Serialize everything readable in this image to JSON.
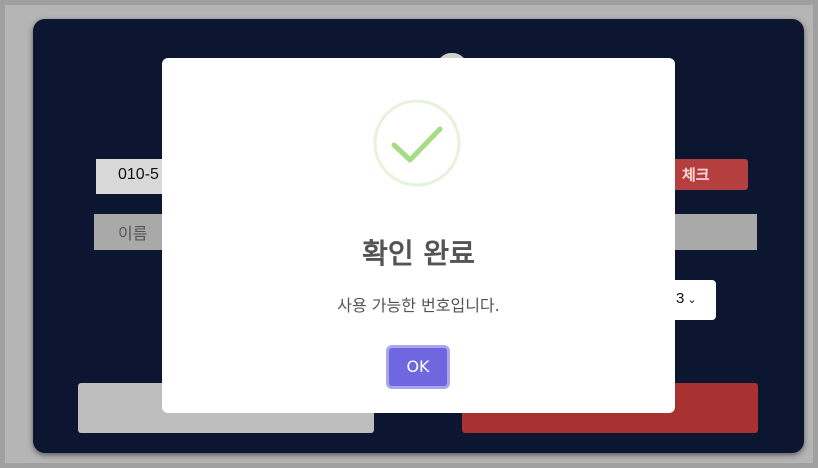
{
  "form": {
    "phone_value": "010-5",
    "check_label": "체크",
    "name_placeholder": "이름",
    "select_value": "3"
  },
  "modal": {
    "icon": "success-check-icon",
    "title": "확인 완료",
    "message": "사용 가능한 번호입니다.",
    "ok_label": "OK"
  },
  "colors": {
    "card_bg": "#0c1631",
    "accent_red": "#a83232",
    "ok_button": "#7066e0",
    "success_green": "#a5dc86"
  }
}
